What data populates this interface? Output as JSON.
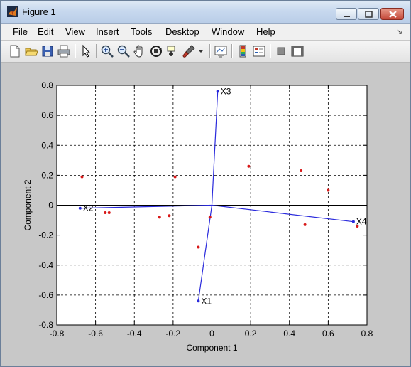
{
  "window": {
    "title": "Figure 1"
  },
  "menu": {
    "items": [
      "File",
      "Edit",
      "View",
      "Insert",
      "Tools",
      "Desktop",
      "Window",
      "Help"
    ]
  },
  "toolbar": {
    "icons": [
      "new-figure",
      "open-file",
      "save",
      "print",
      "edit-plot",
      "zoom-in",
      "zoom-out",
      "pan",
      "rotate-3d",
      "data-cursor",
      "brush",
      "link-plot",
      "colorbar",
      "legend",
      "hide-plot-tools",
      "show-plot-tools"
    ]
  },
  "colors": {
    "vector": "#2a2adc",
    "score": "#d81818",
    "axes_bg": "#ffffff",
    "figure_bg": "#c8c8c8"
  },
  "chart_data": {
    "type": "scatter",
    "title": "",
    "xlabel": "Component 1",
    "ylabel": "Component 2",
    "xlim": [
      -0.8,
      0.8
    ],
    "ylim": [
      -0.8,
      0.8
    ],
    "xticks": [
      -0.8,
      -0.6,
      -0.4,
      -0.2,
      0,
      0.2,
      0.4,
      0.6,
      0.8
    ],
    "yticks": [
      -0.8,
      -0.6,
      -0.4,
      -0.2,
      0,
      0.2,
      0.4,
      0.6,
      0.8
    ],
    "xtick_labels": [
      "-0.8",
      "-0.6",
      "-0.4",
      "-0.2",
      "0",
      "0.2",
      "0.4",
      "0.6",
      "0.8"
    ],
    "ytick_labels": [
      "-0.8",
      "-0.6",
      "-0.4",
      "-0.2",
      "0",
      "0.2",
      "0.4",
      "0.6",
      "0.8"
    ],
    "grid": true,
    "vectors": [
      {
        "name": "X1",
        "x": -0.07,
        "y": -0.64
      },
      {
        "name": "X2",
        "x": -0.68,
        "y": -0.02
      },
      {
        "name": "X3",
        "x": 0.03,
        "y": 0.76
      },
      {
        "name": "X4",
        "x": 0.73,
        "y": -0.11
      }
    ],
    "scores": [
      {
        "x": -0.67,
        "y": 0.19
      },
      {
        "x": -0.55,
        "y": -0.05
      },
      {
        "x": -0.53,
        "y": -0.05
      },
      {
        "x": -0.27,
        "y": -0.08
      },
      {
        "x": -0.22,
        "y": -0.07
      },
      {
        "x": -0.19,
        "y": 0.19
      },
      {
        "x": -0.07,
        "y": -0.28
      },
      {
        "x": -0.01,
        "y": -0.08
      },
      {
        "x": 0.19,
        "y": 0.26
      },
      {
        "x": 0.46,
        "y": 0.23
      },
      {
        "x": 0.48,
        "y": -0.13
      },
      {
        "x": 0.6,
        "y": 0.1
      },
      {
        "x": 0.75,
        "y": -0.14
      }
    ]
  }
}
